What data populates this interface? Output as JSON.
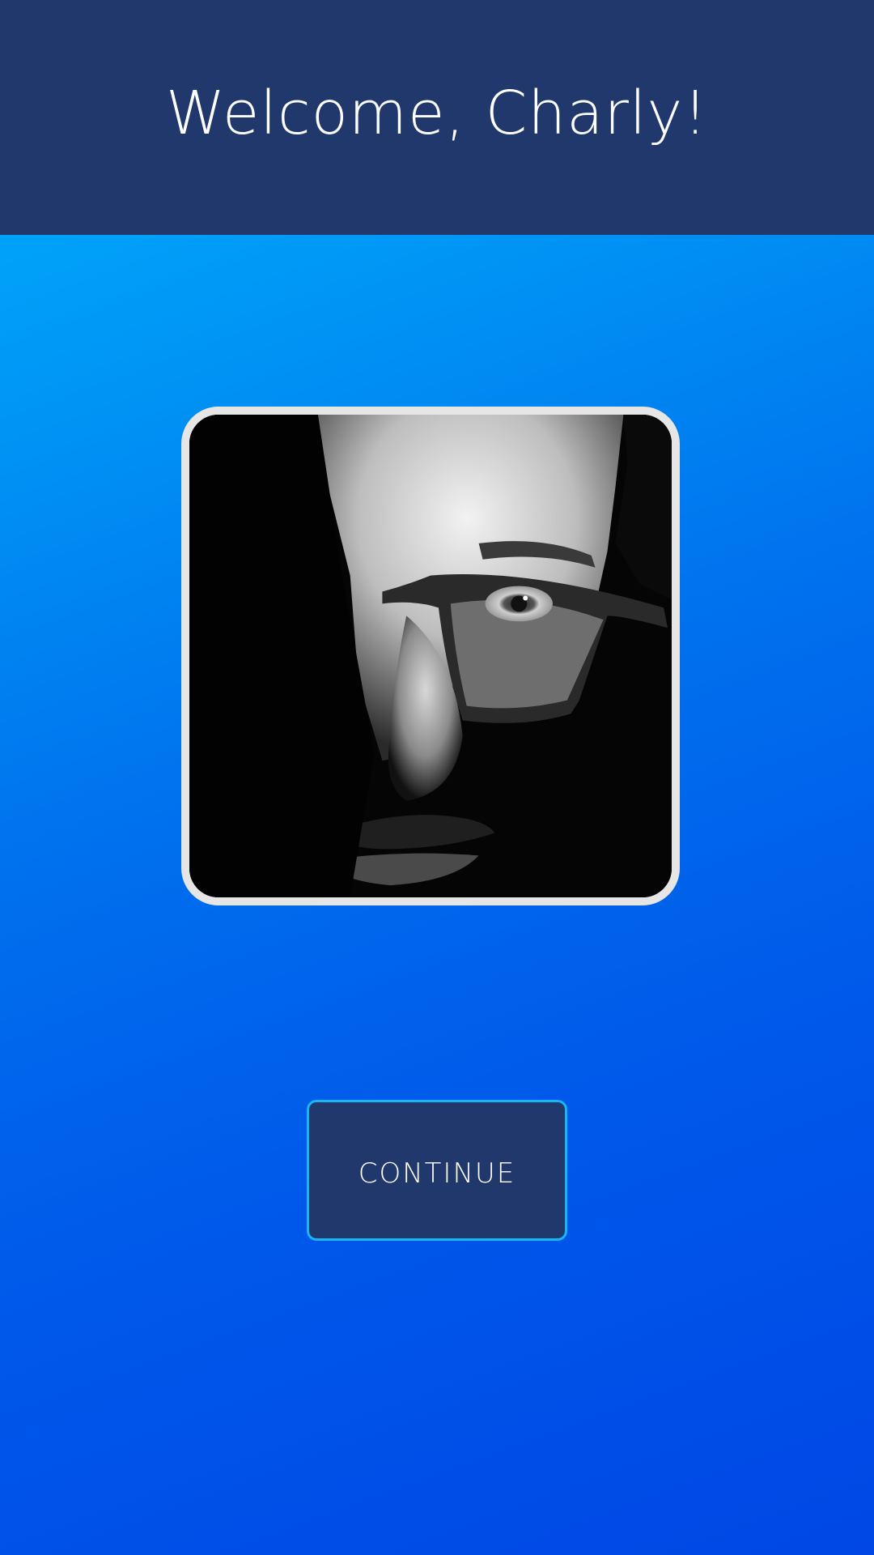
{
  "header": {
    "title": "Welcome, Charly!"
  },
  "profile": {
    "avatar_description": "black-and-white portrait photo of a man with glasses"
  },
  "actions": {
    "continue_label": "CONTINUE"
  },
  "colors": {
    "header_background": "#21386c",
    "background_gradient_top": "#00b4ff",
    "background_gradient_bottom": "#0047e6",
    "button_border": "#17b6f4",
    "avatar_border": "#e6e6e6"
  }
}
